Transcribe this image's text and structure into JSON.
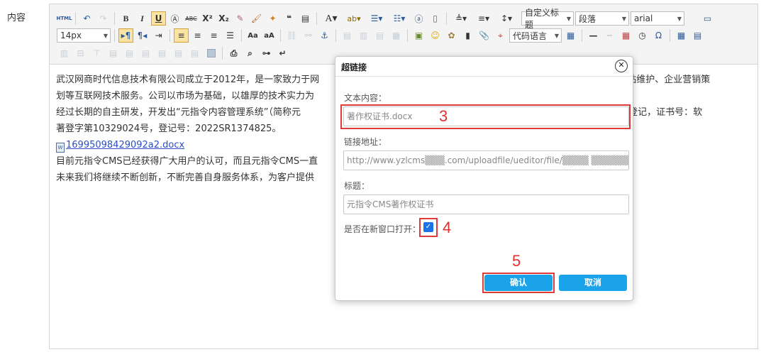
{
  "field": {
    "label": "内容"
  },
  "toolbar": {
    "html_label": "HTML",
    "fontsize_value": "14px",
    "paragraph_style": "自定义标题",
    "paragraph_format": "段落",
    "font_family": "arial",
    "code_language": "代码语言"
  },
  "content": {
    "p1a": "武汉网商时代信息技术有限公司成立于2012年，是一家致力于网",
    "p1b": "、网站维护、企业营销策",
    "p1c": "划等互联网技术服务。公司以市场为基础，以雄厚的技术实力为",
    "p2a": "经过长期的自主研发，开发出“元指令内容管理系统”（简称元",
    "p2b": "局完成登记，证书号：软",
    "p2c": "著登字第10329024号，登记号：2022SR1374825。",
    "link_text": "16995098429092a2.docx",
    "p3": "目前元指令CMS已经获得广大用户的认可，而且元指令CMS一直",
    "p4": "未来我们将继续不断创新，不断完善自身服务体系，为客户提供"
  },
  "dialog": {
    "title": "超链接",
    "text_label": "文本内容：",
    "text_value": "著作权证书.docx",
    "url_label": "链接地址：",
    "url_value": "http://www.yzlcms▒▒▒.com/uploadfile/ueditor/file/▒▒▒▒ ▒▒▒▒▒▒▒▒▒▒",
    "title_label": "标题：",
    "title_value": "元指令CMS著作权证书",
    "new_window_label": "是否在新窗口打开：",
    "new_window_checked": true,
    "confirm_label": "确认",
    "cancel_label": "取消"
  },
  "annotations": {
    "step3": "3",
    "step4": "4",
    "step5": "5"
  },
  "colors": {
    "accent": "#1aa3e8",
    "highlight": "#e03a3a"
  }
}
